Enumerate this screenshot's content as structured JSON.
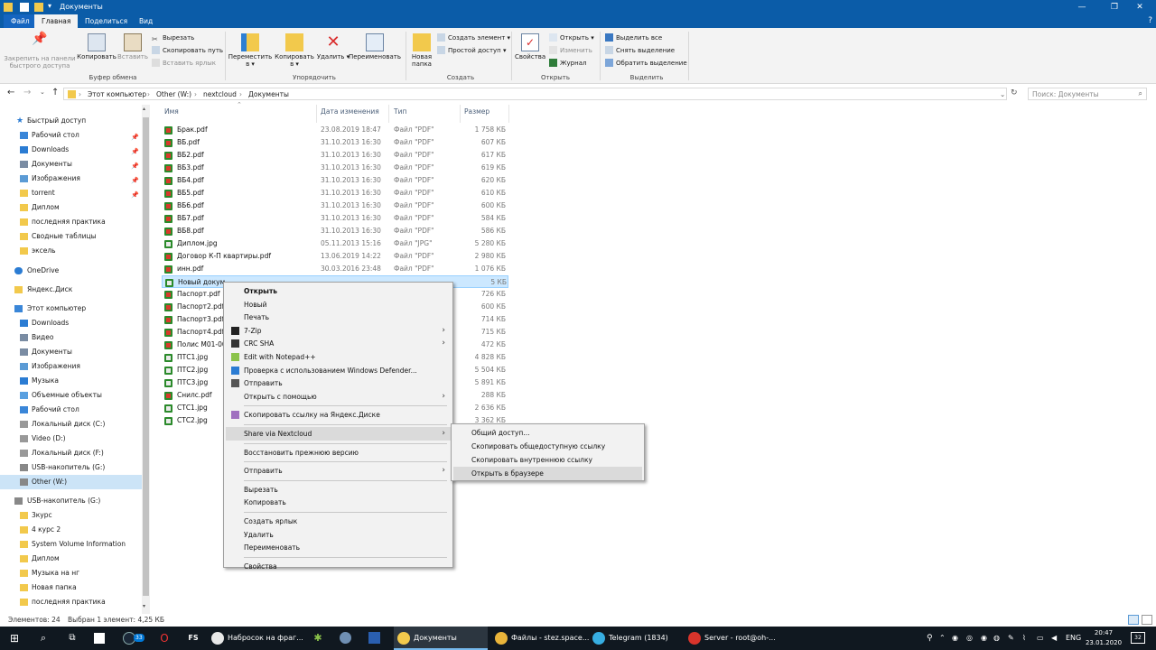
{
  "window": {
    "title": "Документы"
  },
  "ribbon_tabs": [
    "Файл",
    "Главная",
    "Поделиться",
    "Вид"
  ],
  "ribbon": {
    "clipboard": {
      "pin": "Закрепить на панели быстрого доступа",
      "copy": "Копировать",
      "paste": "Вставить",
      "cut": "Вырезать",
      "copy_path": "Скопировать путь",
      "paste_shortcut": "Вставить ярлык",
      "label": "Буфер обмена"
    },
    "organize": {
      "move": "Переместить в ▾",
      "copy_to": "Копировать в ▾",
      "delete": "Удалить ▾",
      "rename": "Переименовать",
      "label": "Упорядочить"
    },
    "create": {
      "new_folder": "Новая папка",
      "new_item": "Создать элемент ▾",
      "easy_access": "Простой доступ ▾",
      "label": "Создать"
    },
    "open": {
      "properties": "Свойства",
      "open": "Открыть ▾",
      "edit": "Изменить",
      "history": "Журнал",
      "label": "Открыть"
    },
    "select": {
      "select_all": "Выделить все",
      "select_none": "Снять выделение",
      "invert": "Обратить выделение",
      "label": "Выделить"
    }
  },
  "address": {
    "crumbs": [
      "Этот компьютер",
      "Other (W:)",
      "nextcloud",
      "Документы"
    ],
    "search_placeholder": "Поиск: Документы"
  },
  "nav": {
    "quick_access": "Быстрый доступ",
    "quick_items": [
      "Рабочий стол",
      "Downloads",
      "Документы",
      "Изображения",
      "torrent",
      "Диплом",
      "последняя практика",
      "Сводные таблицы",
      "эксель"
    ],
    "onedrive": "OneDrive",
    "yandex": "Яндекс.Диск",
    "this_pc": "Этот компьютер",
    "pc_items": [
      "Downloads",
      "Видео",
      "Документы",
      "Изображения",
      "Музыка",
      "Объемные объекты",
      "Рабочий стол",
      "Локальный диск (C:)",
      "Video (D:)",
      "Локальный диск (F:)",
      "USB-накопитель (G:)",
      "Other (W:)"
    ],
    "usb": "USB-накопитель (G:)",
    "usb_items": [
      "3курс",
      "4 курс 2",
      "System Volume Information",
      "Диплом",
      "Музыка на нг",
      "Новая папка",
      "последняя практика"
    ]
  },
  "columns": {
    "name": "Имя",
    "date": "Дата изменения",
    "type": "Тип",
    "size": "Размер"
  },
  "files": [
    {
      "name": "Брак.pdf",
      "date": "23.08.2019 18:47",
      "type": "Файл \"PDF\"",
      "size": "1 758 КБ",
      "kind": "pdf"
    },
    {
      "name": "ВБ.pdf",
      "date": "31.10.2013 16:30",
      "type": "Файл \"PDF\"",
      "size": "607 КБ",
      "kind": "pdf"
    },
    {
      "name": "ВБ2.pdf",
      "date": "31.10.2013 16:30",
      "type": "Файл \"PDF\"",
      "size": "617 КБ",
      "kind": "pdf"
    },
    {
      "name": "ВБ3.pdf",
      "date": "31.10.2013 16:30",
      "type": "Файл \"PDF\"",
      "size": "619 КБ",
      "kind": "pdf"
    },
    {
      "name": "ВБ4.pdf",
      "date": "31.10.2013 16:30",
      "type": "Файл \"PDF\"",
      "size": "620 КБ",
      "kind": "pdf"
    },
    {
      "name": "ВБ5.pdf",
      "date": "31.10.2013 16:30",
      "type": "Файл \"PDF\"",
      "size": "610 КБ",
      "kind": "pdf"
    },
    {
      "name": "ВБ6.pdf",
      "date": "31.10.2013 16:30",
      "type": "Файл \"PDF\"",
      "size": "600 КБ",
      "kind": "pdf"
    },
    {
      "name": "ВБ7.pdf",
      "date": "31.10.2013 16:30",
      "type": "Файл \"PDF\"",
      "size": "584 КБ",
      "kind": "pdf"
    },
    {
      "name": "ВБ8.pdf",
      "date": "31.10.2013 16:30",
      "type": "Файл \"PDF\"",
      "size": "586 КБ",
      "kind": "pdf"
    },
    {
      "name": "Диплом.jpg",
      "date": "05.11.2013 15:16",
      "type": "Файл \"JPG\"",
      "size": "5 280 КБ",
      "kind": "jpg"
    },
    {
      "name": "Договор К-П квартиры.pdf",
      "date": "13.06.2019 14:22",
      "type": "Файл \"PDF\"",
      "size": "2 980 КБ",
      "kind": "pdf"
    },
    {
      "name": "инн.pdf",
      "date": "30.03.2016 23:48",
      "type": "Файл \"PDF\"",
      "size": "1 076 КБ",
      "kind": "pdf"
    },
    {
      "name": "Новый докум",
      "date": "",
      "type": "",
      "size": "5 КБ",
      "kind": "jpg",
      "selected": true
    },
    {
      "name": "Паспорт.pdf",
      "date": "",
      "type": "",
      "size": "726 КБ",
      "kind": "pdf"
    },
    {
      "name": "Паспорт2.pdf",
      "date": "",
      "type": "",
      "size": "600 КБ",
      "kind": "pdf"
    },
    {
      "name": "Паспорт3.pdf",
      "date": "",
      "type": "",
      "size": "714 КБ",
      "kind": "pdf"
    },
    {
      "name": "Паспорт4.pdf",
      "date": "",
      "type": "",
      "size": "715 КБ",
      "kind": "pdf"
    },
    {
      "name": "Полис М01-00",
      "date": "",
      "type": "",
      "size": "472 КБ",
      "kind": "pdf"
    },
    {
      "name": "ПТС1.jpg",
      "date": "",
      "type": "",
      "size": "4 828 КБ",
      "kind": "jpg"
    },
    {
      "name": "ПТС2.jpg",
      "date": "",
      "type": "",
      "size": "5 504 КБ",
      "kind": "jpg"
    },
    {
      "name": "ПТС3.jpg",
      "date": "",
      "type": "",
      "size": "5 891 КБ",
      "kind": "jpg"
    },
    {
      "name": "Снилс.pdf",
      "date": "",
      "type": "",
      "size": "288 КБ",
      "kind": "pdf"
    },
    {
      "name": "СТС1.jpg",
      "date": "",
      "type": "",
      "size": "2 636 КБ",
      "kind": "jpg"
    },
    {
      "name": "СТС2.jpg",
      "date": "",
      "type": "",
      "size": "3 362 КБ",
      "kind": "jpg"
    }
  ],
  "context_menu": [
    {
      "label": "Открыть",
      "bold": true
    },
    {
      "label": "Новый"
    },
    {
      "label": "Печать"
    },
    {
      "label": "7-Zip",
      "sub": true,
      "icon": "7zip-icon"
    },
    {
      "label": "CRC SHA",
      "sub": true,
      "icon": "crc-icon"
    },
    {
      "label": "Edit with Notepad++",
      "icon": "notepad-icon"
    },
    {
      "label": "Проверка с использованием Windows Defender...",
      "icon": "defender-icon"
    },
    {
      "label": "Отправить",
      "icon": "share-icon"
    },
    {
      "label": "Открыть с помощью",
      "sub": true
    },
    {
      "sep": true
    },
    {
      "label": "Скопировать ссылку на Яндекс.Диске",
      "icon": "link-icon"
    },
    {
      "sep": true
    },
    {
      "label": "Share via Nextcloud",
      "sub": true,
      "highlight": true
    },
    {
      "sep": true
    },
    {
      "label": "Восстановить прежнюю версию"
    },
    {
      "sep": true
    },
    {
      "label": "Отправить",
      "sub": true
    },
    {
      "sep": true
    },
    {
      "label": "Вырезать"
    },
    {
      "label": "Копировать"
    },
    {
      "sep": true
    },
    {
      "label": "Создать ярлык"
    },
    {
      "label": "Удалить"
    },
    {
      "label": "Переименовать"
    },
    {
      "sep": true
    },
    {
      "label": "Свойства"
    }
  ],
  "submenu": [
    {
      "label": "Общий доступ..."
    },
    {
      "label": "Скопировать общедоступную ссылку"
    },
    {
      "label": "Скопировать внутреннюю ссылку"
    },
    {
      "label": "Открыть в браузере",
      "highlight": true
    }
  ],
  "status": {
    "count": "Элементов: 24",
    "selected": "Выбран 1 элемент: 4,25 КБ"
  },
  "taskbar": {
    "apps": [
      {
        "label": "Набросок на фраг...",
        "color": "#e8e8e8"
      },
      {
        "label": "Документы",
        "color": "#f2c94c",
        "active": true
      },
      {
        "label": "Файлы - stez.space...",
        "color": "#e9b43a"
      },
      {
        "label": "Telegram (1834)",
        "color": "#37aee2"
      },
      {
        "label": "Server - root@oh-...",
        "color": "#d9342b"
      }
    ],
    "fs_label": "FS",
    "badge": "33",
    "lang": "ENG",
    "time": "20:47",
    "date": "23.01.2020",
    "notif_count": "32"
  }
}
